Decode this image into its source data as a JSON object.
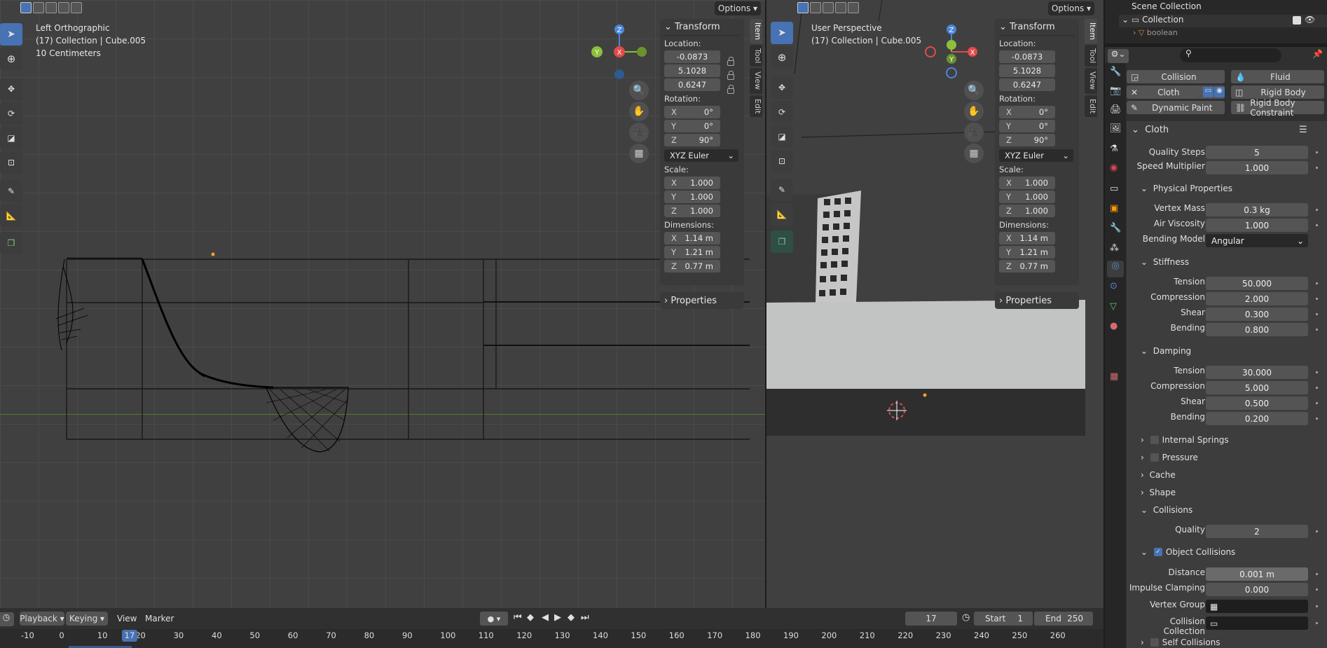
{
  "left_viewport": {
    "view_name": "Left Orthographic",
    "object_path": "(17) Collection | Cube.005",
    "scale_label": "10 Centimeters",
    "options_label": "Options"
  },
  "right_viewport": {
    "view_name": "User Perspective",
    "object_path": "(17) Collection | Cube.005",
    "options_label": "Options"
  },
  "side_tabs": [
    "Item",
    "Tool",
    "View",
    "Edit"
  ],
  "gizmo": {
    "z": "Z",
    "y": "Y",
    "x": "X"
  },
  "transform": {
    "title": "Transform",
    "location_label": "Location:",
    "location": [
      "-0.0873",
      "5.1028",
      "0.6247"
    ],
    "rotation_label": "Rotation:",
    "rotation": [
      {
        "axis": "X",
        "value": "0°"
      },
      {
        "axis": "Y",
        "value": "0°"
      },
      {
        "axis": "Z",
        "value": "90°"
      }
    ],
    "rotation_mode": "XYZ Euler",
    "scale_label": "Scale:",
    "scale": [
      {
        "axis": "X",
        "value": "1.000"
      },
      {
        "axis": "Y",
        "value": "1.000"
      },
      {
        "axis": "Z",
        "value": "1.000"
      }
    ],
    "dimensions_label": "Dimensions:",
    "dimensions": [
      {
        "axis": "X",
        "value": "1.14 m"
      },
      {
        "axis": "Y",
        "value": "1.21 m"
      },
      {
        "axis": "Z",
        "value": "0.77 m"
      }
    ],
    "properties_label": "Properties"
  },
  "outliner": {
    "scene_collection": "Scene Collection",
    "collection": "Collection",
    "item": "boolean"
  },
  "physics": {
    "buttons": [
      "Collision",
      "Fluid",
      "Cloth",
      "Rigid Body",
      "Dynamic Paint",
      "Rigid Body Constraint"
    ],
    "cloth_title": "Cloth",
    "quality_steps": {
      "label": "Quality Steps",
      "value": "5"
    },
    "speed_multiplier": {
      "label": "Speed Multiplier",
      "value": "1.000"
    },
    "physical_properties": "Physical Properties",
    "vertex_mass": {
      "label": "Vertex Mass",
      "value": "0.3 kg"
    },
    "air_viscosity": {
      "label": "Air Viscosity",
      "value": "1.000"
    },
    "bending_model": {
      "label": "Bending Model",
      "value": "Angular"
    },
    "stiffness": "Stiffness",
    "stiff_tension": {
      "label": "Tension",
      "value": "50.000"
    },
    "stiff_compression": {
      "label": "Compression",
      "value": "2.000"
    },
    "stiff_shear": {
      "label": "Shear",
      "value": "0.300"
    },
    "stiff_bending": {
      "label": "Bending",
      "value": "0.800"
    },
    "damping": "Damping",
    "damp_tension": {
      "label": "Tension",
      "value": "30.000"
    },
    "damp_compression": {
      "label": "Compression",
      "value": "5.000"
    },
    "damp_shear": {
      "label": "Shear",
      "value": "0.500"
    },
    "damp_bending": {
      "label": "Bending",
      "value": "0.200"
    },
    "internal_springs": "Internal Springs",
    "pressure": "Pressure",
    "cache": "Cache",
    "shape": "Shape",
    "collisions": "Collisions",
    "quality": {
      "label": "Quality",
      "value": "2"
    },
    "object_collisions": "Object Collisions",
    "distance": {
      "label": "Distance",
      "value": "0.001 m"
    },
    "impulse_clamping": {
      "label": "Impulse Clamping",
      "value": "0.000"
    },
    "vertex_group": "Vertex Group",
    "collision_collection": "Collision Collection",
    "self_collisions": "Self Collisions"
  },
  "timeline": {
    "playback": "Playback",
    "keying": "Keying",
    "view": "View",
    "marker": "Marker",
    "current_frame": "17",
    "start_label": "Start",
    "start": "1",
    "end_label": "End",
    "end": "250",
    "ruler": [
      "-10",
      "0",
      "10",
      "20",
      "30",
      "40",
      "50",
      "60",
      "70",
      "80",
      "90",
      "100",
      "110",
      "120",
      "130",
      "140",
      "150",
      "160",
      "170",
      "180",
      "190",
      "200",
      "210",
      "220",
      "230",
      "240",
      "250",
      "260"
    ],
    "frame_marker": "17"
  },
  "colors": {
    "accent": "#4772b3",
    "x_axis": "#e04b4b",
    "y_axis": "#8bbf3c",
    "z_axis": "#4a86d8"
  }
}
